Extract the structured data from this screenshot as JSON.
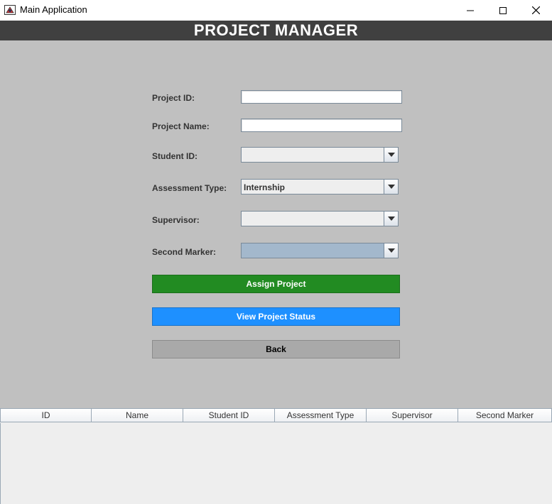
{
  "window": {
    "title": "Main Application",
    "icon": "java-app-icon",
    "controls": [
      "minimize-icon",
      "maximize-icon",
      "close-icon"
    ]
  },
  "header": {
    "title": "PROJECT MANAGER"
  },
  "form": {
    "project_id": {
      "label": "Project ID:",
      "value": ""
    },
    "project_name": {
      "label": "Project Name:",
      "value": ""
    },
    "student_id": {
      "label": "Student ID:",
      "value": ""
    },
    "assessment_type": {
      "label": "Assessment Type:",
      "value": "Internship"
    },
    "supervisor": {
      "label": "Supervisor:",
      "value": ""
    },
    "second_marker": {
      "label": "Second Marker:",
      "value": ""
    }
  },
  "buttons": {
    "assign": "Assign Project",
    "view_status": "View Project Status",
    "back": "Back"
  },
  "table": {
    "columns": [
      "ID",
      "Name",
      "Student ID",
      "Assessment Type",
      "Supervisor",
      "Second Marker"
    ],
    "rows": []
  },
  "colors": {
    "header_bg": "#404040",
    "form_bg": "#c0c0c0",
    "assign_button": "#228b22",
    "view_button": "#1e90ff",
    "back_button": "#a9a9a9"
  }
}
